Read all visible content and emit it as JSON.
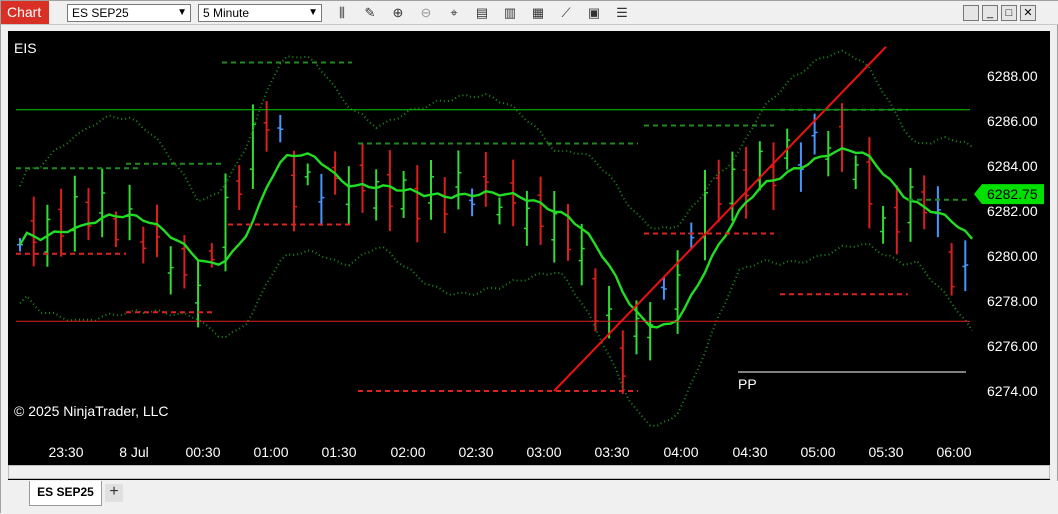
{
  "toolbar": {
    "chart_tab_label": "Chart",
    "instrument": "ES SEP25",
    "interval": "5 Minute",
    "icons": [
      "bar-type-icon",
      "draw-pencil-icon",
      "zoom-in-icon",
      "zoom-out-icon",
      "crosshair-icon",
      "data-box-icon",
      "indicators-icon",
      "strategies-icon",
      "chart-trader-icon",
      "properties-icon",
      "templates-icon"
    ],
    "window_buttons": [
      "minimize",
      "restore",
      "maximize",
      "close"
    ]
  },
  "chart": {
    "instrument_label": "EIS",
    "copyright": "© 2025 NinjaTrader, LLC",
    "pivot_label": "PP",
    "last_price_label": "6282.75",
    "last_price_color": "#00e000",
    "up_color": "#32dc32",
    "down_color": "#dc1e1e",
    "neutral_color": "#4696ff"
  },
  "chart_data": {
    "type": "ohlc",
    "x_tick_labels": [
      "23:30",
      "8 Jul",
      "00:30",
      "01:00",
      "01:30",
      "02:00",
      "02:30",
      "03:00",
      "03:30",
      "04:00",
      "04:30",
      "05:00",
      "05:30",
      "06:00"
    ],
    "y_tick_labels": [
      "6288.00",
      "6286.00",
      "6284.00",
      "6282.00",
      "6280.00",
      "6278.00",
      "6276.00",
      "6274.00"
    ],
    "ylim": [
      6273.5,
      6289.0
    ],
    "grid": false,
    "horizontal_lines": [
      {
        "price": 6286.5,
        "color": "#00cc00"
      },
      {
        "price": 6277.1,
        "color": "#dd2222"
      }
    ],
    "trend_line": {
      "from": [
        "03:00",
        6274.0
      ],
      "to": [
        "05:25",
        6289.2
      ],
      "color": "#ee1111"
    }
  },
  "tabs": {
    "active": "ES SEP25",
    "add": "+"
  }
}
